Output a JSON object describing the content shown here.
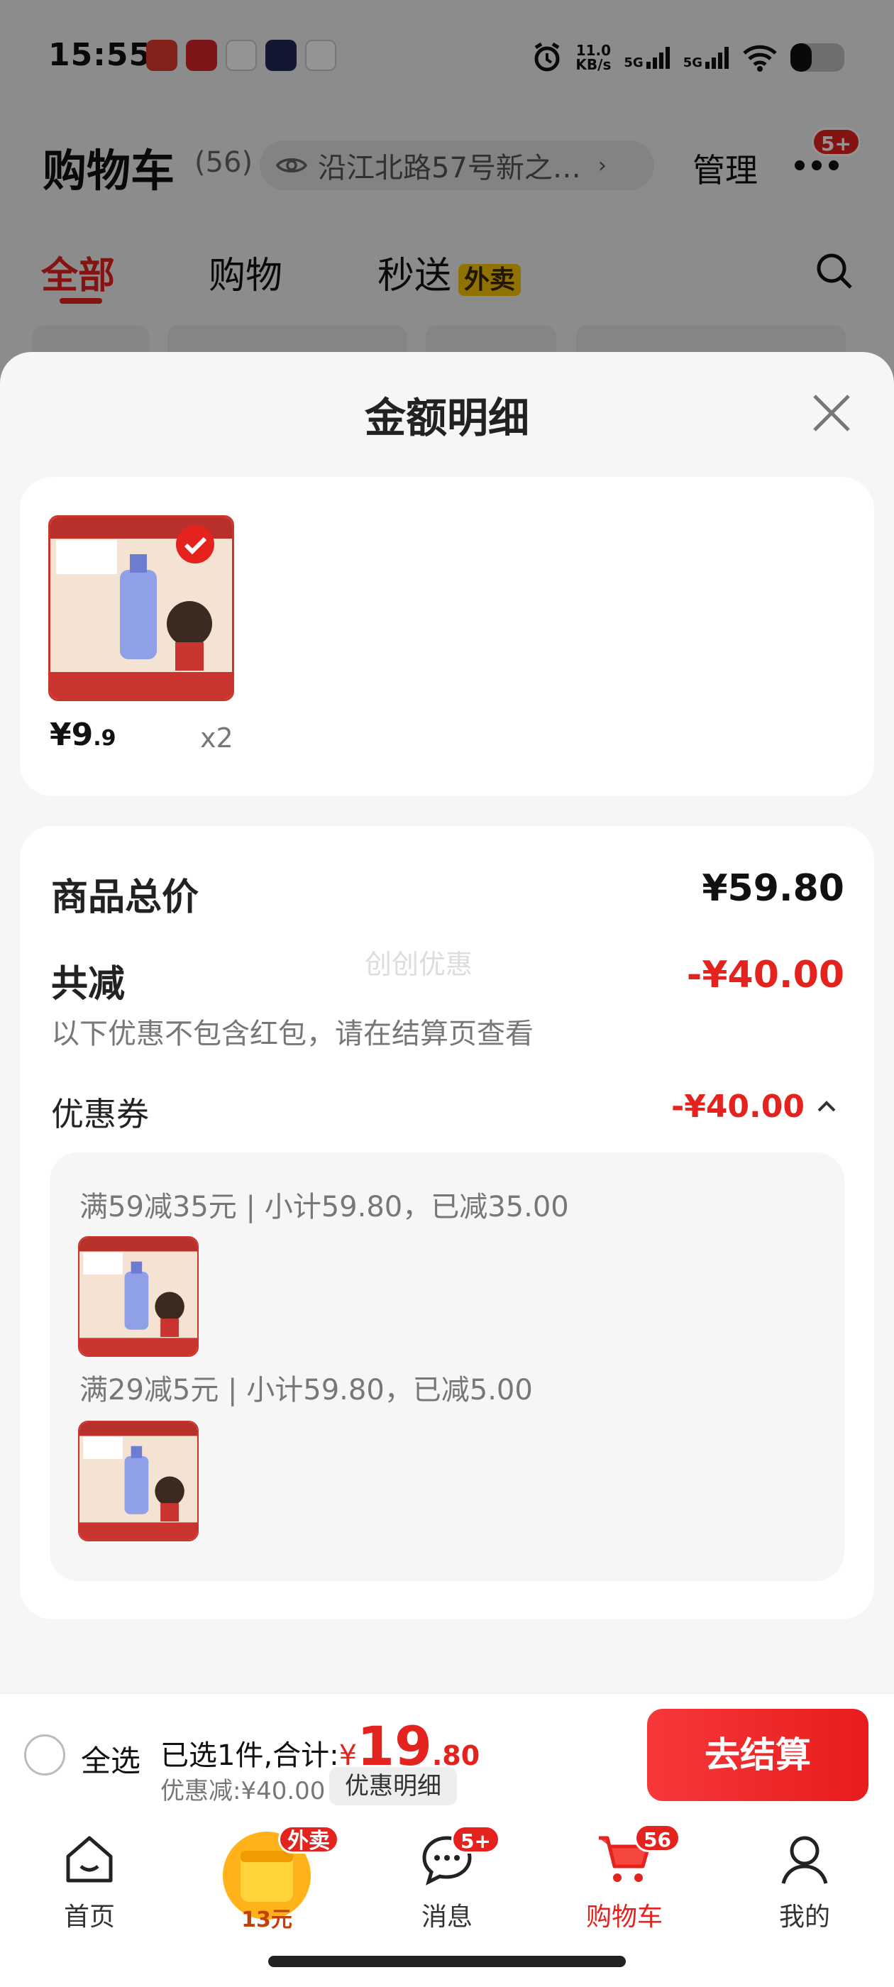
{
  "status_bar": {
    "time": "15:55",
    "net_speed_value": "11.0",
    "net_speed_unit": "KB/s",
    "signal_1": "5G",
    "signal_2": "5G"
  },
  "header": {
    "title": "购物车",
    "count": "(56)",
    "address": "沿江北路57号新之…",
    "manage": "管理",
    "more_badge": "5+"
  },
  "tabs": [
    {
      "label": "全部",
      "active": true
    },
    {
      "label": "购物"
    },
    {
      "label": "秒送",
      "tag": "外卖"
    }
  ],
  "sheet": {
    "title": "金额明细",
    "product": {
      "price_int": "¥9",
      "price_dec": ".9",
      "qty": "x2"
    },
    "summary": {
      "total_label": "商品总价",
      "total_value": "¥59.80",
      "discount_label": "共减",
      "discount_value": "-¥40.00",
      "note": "以下优惠不包含红包，请在结算页查看",
      "watermark": "创创优惠",
      "coupon_label": "优惠券",
      "coupon_value": "-¥40.00"
    },
    "coupon_details": [
      "满59减35元 | 小计59.80，已减35.00",
      "满29减5元 | 小计59.80，已减5.00"
    ]
  },
  "bottom_bar": {
    "select_all": "全选",
    "selected_prefix": "已选1件,合计:",
    "currency": "¥",
    "total_int": "19",
    "total_dec": ".80",
    "discount_text": "优惠减:¥40.00",
    "detail_button": "优惠明细",
    "checkout_button": "去结算"
  },
  "nav": [
    {
      "label": "首页",
      "icon": "home-icon"
    },
    {
      "label": "",
      "icon": "takeout-coupon-icon",
      "badge": "外卖",
      "coupon": "13元"
    },
    {
      "label": "消息",
      "icon": "message-icon",
      "badge": "5+"
    },
    {
      "label": "购物车",
      "icon": "cart-icon",
      "badge": "56",
      "active": true
    },
    {
      "label": "我的",
      "icon": "profile-icon"
    }
  ],
  "colors": {
    "accent": "#e4231f",
    "tag_yellow": "#f7c400"
  }
}
